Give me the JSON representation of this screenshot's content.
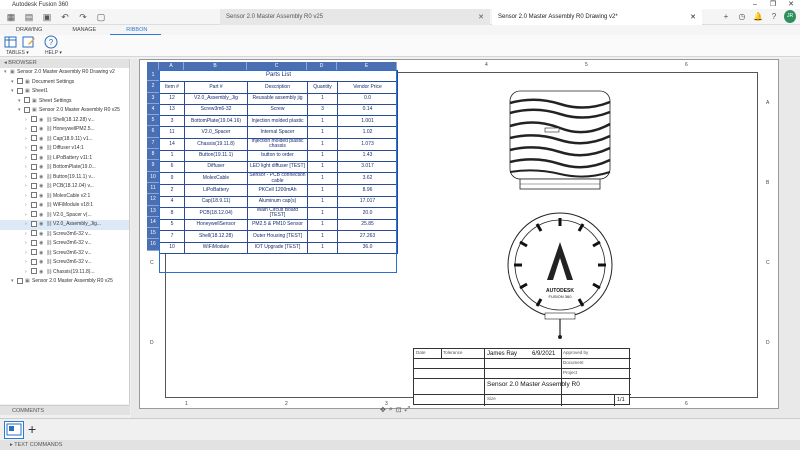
{
  "app": {
    "title": "Autodesk Fusion 360"
  },
  "tabs": [
    {
      "label": "Sensor 2.0 Master Assembly R0 v25"
    },
    {
      "label": "Sensor 2.0 Master Assembly R0 Drawing v2*"
    }
  ],
  "ribbon": {
    "tabs": [
      "DRAWING",
      "MANAGE",
      "RIBBON"
    ],
    "active_tab": "RIBBON",
    "groups": {
      "tables": "TABLES ▾",
      "help": "HELP ▾"
    }
  },
  "browser": {
    "header": "BROWSER",
    "items": [
      {
        "label": "Sensor 2.0 Master Assembly R0 Drawing v2",
        "level": 0
      },
      {
        "label": "Document Settings",
        "level": 1
      },
      {
        "label": "Sheet1",
        "level": 1
      },
      {
        "label": "Sheet Settings",
        "level": 2
      },
      {
        "label": "Sensor 2.0 Master Assembly R0 v25",
        "level": 2
      },
      {
        "label": "Shell(18.12.28) v...",
        "level": 3
      },
      {
        "label": "HoneywellPM2.5...",
        "level": 3
      },
      {
        "label": "Cap(18.9.11) v1...",
        "level": 3
      },
      {
        "label": "Diffuser v14:1",
        "level": 3
      },
      {
        "label": "LiPoBattery v11:1",
        "level": 3
      },
      {
        "label": "BottomPlate(19.0...",
        "level": 3
      },
      {
        "label": "Button(19.11.1) v...",
        "level": 3
      },
      {
        "label": "PCB(18.12.04) v...",
        "level": 3
      },
      {
        "label": "MolexCable v2:1",
        "level": 3
      },
      {
        "label": "WiFiModule v18:1",
        "level": 3
      },
      {
        "label": "V2.0_Spacer v(...",
        "level": 3
      },
      {
        "label": "V2.0_Assembly_Jig...",
        "level": 3
      },
      {
        "label": "Screw3m6-32 v...",
        "level": 3
      },
      {
        "label": "Screw3m6-32 v...",
        "level": 3
      },
      {
        "label": "Screw3m6-32 v...",
        "level": 3
      },
      {
        "label": "Screw3m6-32 v...",
        "level": 3
      },
      {
        "label": "Chassis(19.11.8)...",
        "level": 3
      },
      {
        "label": "Sensor 2.0 Master Assembly R0 v25",
        "level": 1
      }
    ]
  },
  "comments": {
    "label": "COMMENTS"
  },
  "text_commands": {
    "label": "TEXT COMMANDS"
  },
  "table": {
    "columns": [
      "A",
      "B",
      "C",
      "D",
      "E"
    ],
    "title": "Parts List",
    "headers": [
      "Item #",
      "Part #",
      "Description",
      "Quantity",
      "Vendor Price"
    ],
    "rows": [
      [
        "12",
        "V2.0_Assembly_Jig",
        "Reusable assembly jig",
        "1",
        "0.0"
      ],
      [
        "13",
        "Screw3m6-32",
        "Screw",
        "3",
        "0.14"
      ],
      [
        "3",
        "BottomPlate(19.04.16)",
        "Injection molded plastic",
        "1",
        "1.001"
      ],
      [
        "11",
        "V2.0_Spacer",
        "Internal Spacer",
        "1",
        "1.02"
      ],
      [
        "14",
        "Chassis(19.11.8)",
        "Injection molded plastic chassis",
        "1",
        "1.073"
      ],
      [
        "1",
        "Button(19.11.1)",
        "button to order",
        "1",
        "1.43"
      ],
      [
        "6",
        "Diffuser",
        "LED light diffuser [TEST]",
        "1",
        "3.017"
      ],
      [
        "9",
        "MolexCable",
        "Sensor - PCB connection cable",
        "1",
        "3.62"
      ],
      [
        "2",
        "LiPoBattery",
        "PKCell 1200mAh",
        "1",
        "8.96"
      ],
      [
        "4",
        "Cap(18.9.11)",
        "Aluminum cap(s)",
        "1",
        "17.017"
      ],
      [
        "8",
        "PCB(18.12.04)",
        "Main Circuit Board [TEST]",
        "1",
        "20.0"
      ],
      [
        "5",
        "HoneywellSensor",
        "PM2.5 & PM10 Sensor",
        "1",
        "25.85"
      ],
      [
        "7",
        "Shell(18.12.28)",
        "Outer Housing [TEST]",
        "1",
        "27.263"
      ],
      [
        "10",
        "WiFiModule",
        "IOT Upgrade [TEST]",
        "1",
        "36.0"
      ]
    ],
    "row_numbers": [
      "1",
      "2",
      "3",
      "4",
      "5",
      "6",
      "7",
      "8",
      "9",
      "10",
      "11",
      "12",
      "13",
      "14",
      "15",
      "16"
    ]
  },
  "titleblock": {
    "date_label": "Date",
    "tolerance_label": "Tolerance",
    "approved_label": "Approved by",
    "author": "James Ray",
    "date": "6/9/2021",
    "title": "Sensor 2.0 Master Assembly R0",
    "size_label": "Size",
    "sheet": "1/1",
    "document_label": "Document",
    "project_label": "Project"
  },
  "drawing": {
    "logo_text_1": "AUTODESK",
    "logo_text_2": "FUSION 360"
  },
  "zones": {
    "top": [
      "1",
      "2",
      "3",
      "4",
      "5",
      "6"
    ],
    "bottom": [
      "1",
      "2",
      "3",
      "4",
      "5",
      "6"
    ],
    "left": [
      "A",
      "B",
      "C",
      "D"
    ],
    "right": [
      "A",
      "B",
      "C",
      "D"
    ]
  }
}
